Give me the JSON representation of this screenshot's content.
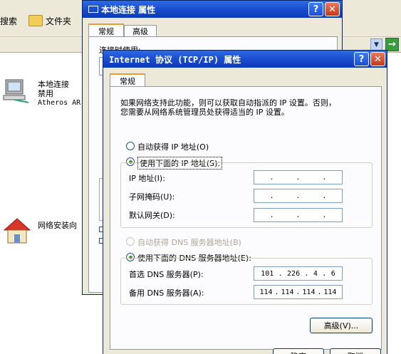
{
  "explorer": {
    "toolbar": {
      "search_label": "搜索",
      "folders_label": "文件夹"
    },
    "connection_item": {
      "name": "本地连接",
      "status": "禁用",
      "adapter": "Atheros AR"
    },
    "wizard_item": {
      "label": "网络安装向"
    }
  },
  "local_props": {
    "title": "本地连接 属性",
    "tabs": [
      "常规",
      "高级"
    ],
    "connect_using_label": "连接时使用:"
  },
  "tcpip": {
    "title": "Internet 协议 (TCP/IP) 属性",
    "tab": "常规",
    "description_line1": "如果网络支持此功能，则可以获取自动指派的 IP 设置。否则，",
    "description_line2": "您需要从网络系统管理员处获得适当的 IP 设置。",
    "auto_ip_label": "自动获得 IP 地址(O)",
    "manual_ip_label": "使用下面的 IP 地址(S):",
    "ip_address_label": "IP 地址(I):",
    "subnet_label": "子网掩码(U):",
    "gateway_label": "默认网关(D):",
    "auto_dns_label": "自动获得 DNS 服务器地址(B)",
    "manual_dns_label": "使用下面的 DNS 服务器地址(E):",
    "preferred_dns_label": "首选 DNS 服务器(P):",
    "alternate_dns_label": "备用 DNS 服务器(A):",
    "preferred_dns": [
      "101",
      "226",
      "4",
      "6"
    ],
    "alternate_dns": [
      "114",
      "114",
      "114",
      "114"
    ],
    "advanced_button": "高级(V)...",
    "ok_button": "确定",
    "cancel_button": "取消"
  },
  "colors": {
    "titlebar": "#1c4fd0",
    "dialog_bg": "#ece9d8",
    "panel_bg": "#fcfcfe"
  }
}
